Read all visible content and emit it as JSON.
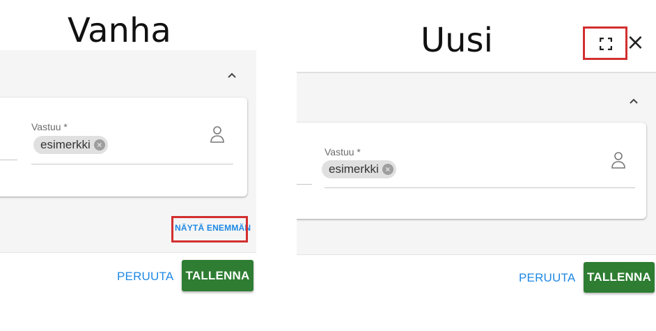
{
  "left": {
    "heading": "Vanha",
    "field_label": "Vastuu *",
    "chip_value": "esimerkki",
    "show_more_label": "NÄYTÄ ENEMMÄN",
    "cancel_label": "PERUUTA",
    "save_label": "TALLENNA"
  },
  "right": {
    "heading": "Uusi",
    "close_glyph": "×",
    "field_label": "Vastuu *",
    "chip_value": "esimerkki",
    "cancel_label": "PERUUTA",
    "save_label": "TALLENNA"
  },
  "colors": {
    "accent_blue": "#1e88e5",
    "save_green": "#2e7d32",
    "highlight_red": "#d32f2f"
  },
  "icons": [
    "chevron-up-icon",
    "person-icon",
    "chip-close-icon",
    "fullscreen-icon",
    "close-icon"
  ]
}
